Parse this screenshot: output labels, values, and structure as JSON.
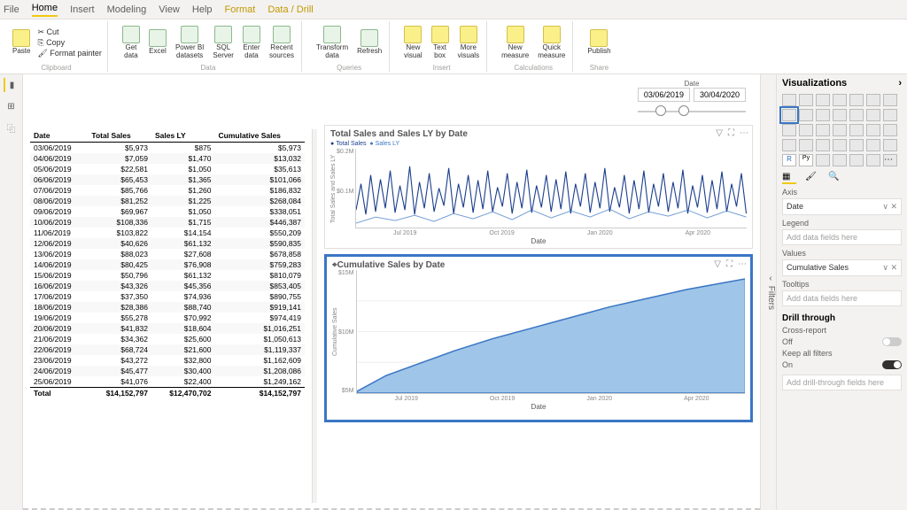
{
  "menu": {
    "items": [
      "File",
      "Home",
      "Insert",
      "Modeling",
      "View",
      "Help",
      "Format",
      "Data / Drill"
    ],
    "active": 1,
    "highlight": [
      6,
      7
    ]
  },
  "ribbon": {
    "clipboard": {
      "cut": "Cut",
      "copy": "Copy",
      "format_painter": "Format painter",
      "paste": "Paste",
      "label": "Clipboard"
    },
    "data": {
      "items": [
        "Get\ndata",
        "Excel",
        "Power BI\ndatasets",
        "SQL\nServer",
        "Enter\ndata",
        "Recent\nsources"
      ],
      "label": "Data"
    },
    "queries": {
      "items": [
        "Transform\ndata",
        "Refresh"
      ],
      "label": "Queries"
    },
    "insert": {
      "items": [
        "New\nvisual",
        "Text\nbox",
        "More\nvisuals"
      ],
      "label": "Insert"
    },
    "calc": {
      "items": [
        "New\nmeasure",
        "Quick\nmeasure"
      ],
      "label": "Calculations"
    },
    "share": {
      "items": [
        "Publish"
      ],
      "label": "Share"
    }
  },
  "slicer": {
    "label": "Date",
    "from": "03/06/2019",
    "to": "30/04/2020"
  },
  "table": {
    "headers": [
      "Date",
      "Total Sales",
      "Sales LY",
      "Cumulative Sales"
    ],
    "rows": [
      [
        "03/06/2019",
        "$5,973",
        "$875",
        "$5,973"
      ],
      [
        "04/06/2019",
        "$7,059",
        "$1,470",
        "$13,032"
      ],
      [
        "05/06/2019",
        "$22,581",
        "$1,050",
        "$35,613"
      ],
      [
        "06/06/2019",
        "$65,453",
        "$1,365",
        "$101,066"
      ],
      [
        "07/06/2019",
        "$85,766",
        "$1,260",
        "$186,832"
      ],
      [
        "08/06/2019",
        "$81,252",
        "$1,225",
        "$268,084"
      ],
      [
        "09/06/2019",
        "$69,967",
        "$1,050",
        "$338,051"
      ],
      [
        "10/06/2019",
        "$108,336",
        "$1,715",
        "$446,387"
      ],
      [
        "11/06/2019",
        "$103,822",
        "$14,154",
        "$550,209"
      ],
      [
        "12/06/2019",
        "$40,626",
        "$61,132",
        "$590,835"
      ],
      [
        "13/06/2019",
        "$88,023",
        "$27,608",
        "$678,858"
      ],
      [
        "14/06/2019",
        "$80,425",
        "$76,908",
        "$759,283"
      ],
      [
        "15/06/2019",
        "$50,796",
        "$61,132",
        "$810,079"
      ],
      [
        "16/06/2019",
        "$43,326",
        "$45,356",
        "$853,405"
      ],
      [
        "17/06/2019",
        "$37,350",
        "$74,936",
        "$890,755"
      ],
      [
        "18/06/2019",
        "$28,386",
        "$88,740",
        "$919,141"
      ],
      [
        "19/06/2019",
        "$55,278",
        "$70,992",
        "$974,419"
      ],
      [
        "20/06/2019",
        "$41,832",
        "$18,604",
        "$1,016,251"
      ],
      [
        "21/06/2019",
        "$34,362",
        "$25,600",
        "$1,050,613"
      ],
      [
        "22/06/2019",
        "$68,724",
        "$21,600",
        "$1,119,337"
      ],
      [
        "23/06/2019",
        "$43,272",
        "$32,800",
        "$1,162,609"
      ],
      [
        "24/06/2019",
        "$45,477",
        "$30,400",
        "$1,208,086"
      ],
      [
        "25/06/2019",
        "$41,076",
        "$22,400",
        "$1,249,162"
      ]
    ],
    "footer": [
      "Total",
      "$14,152,797",
      "$12,470,702",
      "$14,152,797"
    ]
  },
  "chart1": {
    "title": "Total Sales and Sales LY by Date",
    "legend": [
      "Total Sales",
      "Sales LY"
    ],
    "yticks": [
      "$0.2M",
      "$0.1M",
      ""
    ],
    "xticks": [
      "Jul 2019",
      "Oct 2019",
      "Jan 2020",
      "Apr 2020"
    ],
    "xtitle": "Date",
    "ytitle": "Total Sales and Sales LY"
  },
  "chart2": {
    "title": "Cumulative Sales by Date",
    "yticks": [
      "$15M",
      "$10M",
      "$5M"
    ],
    "xticks": [
      "Jul 2019",
      "Oct 2019",
      "Jan 2020",
      "Apr 2020"
    ],
    "xtitle": "Date",
    "ytitle": "Cumulative Sales"
  },
  "vizpane": {
    "title": "Visualizations",
    "axis": {
      "label": "Axis",
      "value": "Date"
    },
    "legend": {
      "label": "Legend",
      "placeholder": "Add data fields here"
    },
    "values": {
      "label": "Values",
      "value": "Cumulative Sales"
    },
    "tooltips": {
      "label": "Tooltips",
      "placeholder": "Add data fields here"
    },
    "drill": {
      "title": "Drill through",
      "cross": "Cross-report",
      "off": "Off",
      "keep": "Keep all filters",
      "on": "On",
      "placeholder": "Add drill-through fields here"
    },
    "filters": "Filters"
  },
  "chart_data": [
    {
      "type": "line",
      "title": "Total Sales and Sales LY by Date",
      "xlabel": "Date",
      "ylabel": "Total Sales and Sales LY",
      "ylim": [
        0,
        200000
      ],
      "x_range": [
        "2019-06-03",
        "2020-04-30"
      ],
      "series": [
        {
          "name": "Total Sales",
          "note": "daily spiky series ~0–0.2M, visually dense; exact values in table.rows col 2"
        },
        {
          "name": "Sales LY",
          "note": "daily series lower magnitude; exact values in table.rows col 3"
        }
      ]
    },
    {
      "type": "area",
      "title": "Cumulative Sales by Date",
      "xlabel": "Date",
      "ylabel": "Cumulative Sales",
      "ylim": [
        0,
        15000000
      ],
      "x": [
        "2019-06-03",
        "2019-07-01",
        "2019-10-01",
        "2020-01-01",
        "2020-04-01",
        "2020-04-30"
      ],
      "values": [
        0,
        1300000,
        5800000,
        9500000,
        13000000,
        14152797
      ]
    }
  ]
}
